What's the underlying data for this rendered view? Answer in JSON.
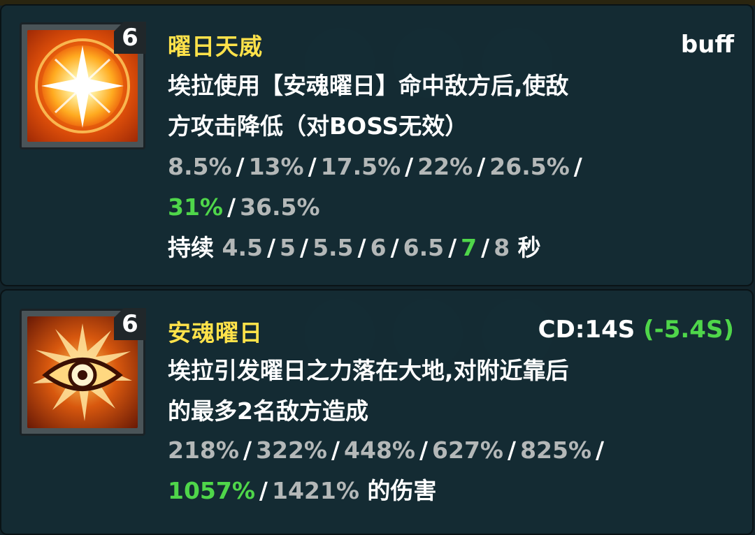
{
  "skills": [
    {
      "level": "6",
      "name": "曜日天威",
      "tag": "buff",
      "desc_lines": [
        "埃拉使用【安魂曜日】命中敌方后,使敌",
        "方攻击降低（对BOSS无效）"
      ],
      "values_line1": [
        "8.5%",
        "13%",
        "17.5%",
        "22%",
        "26.5%"
      ],
      "values_line2": [
        "31%",
        "36.5%"
      ],
      "duration_label": "持续",
      "duration_values": [
        "4.5",
        "5",
        "5.5",
        "6",
        "6.5",
        "7",
        "8"
      ],
      "duration_unit": "秒"
    },
    {
      "level": "6",
      "name": "安魂曜日",
      "cd_text": "CD:14S",
      "cd_bonus": "(-5.4S)",
      "desc_lines": [
        "埃拉引发曜日之力落在大地,对附近靠后",
        "的最多2名敌方造成"
      ],
      "values_line1": [
        "218%",
        "322%",
        "448%",
        "627%",
        "825%"
      ],
      "values_line2": [
        "1057%",
        "1421%"
      ],
      "damage_suffix": "的伤害"
    }
  ],
  "colors": {
    "name": "#ffe24a",
    "highlight": "#4fd64a",
    "value": "#b4b8b8",
    "text": "#ffffff"
  },
  "icons": [
    "sun-burst-icon",
    "sun-eye-icon"
  ]
}
